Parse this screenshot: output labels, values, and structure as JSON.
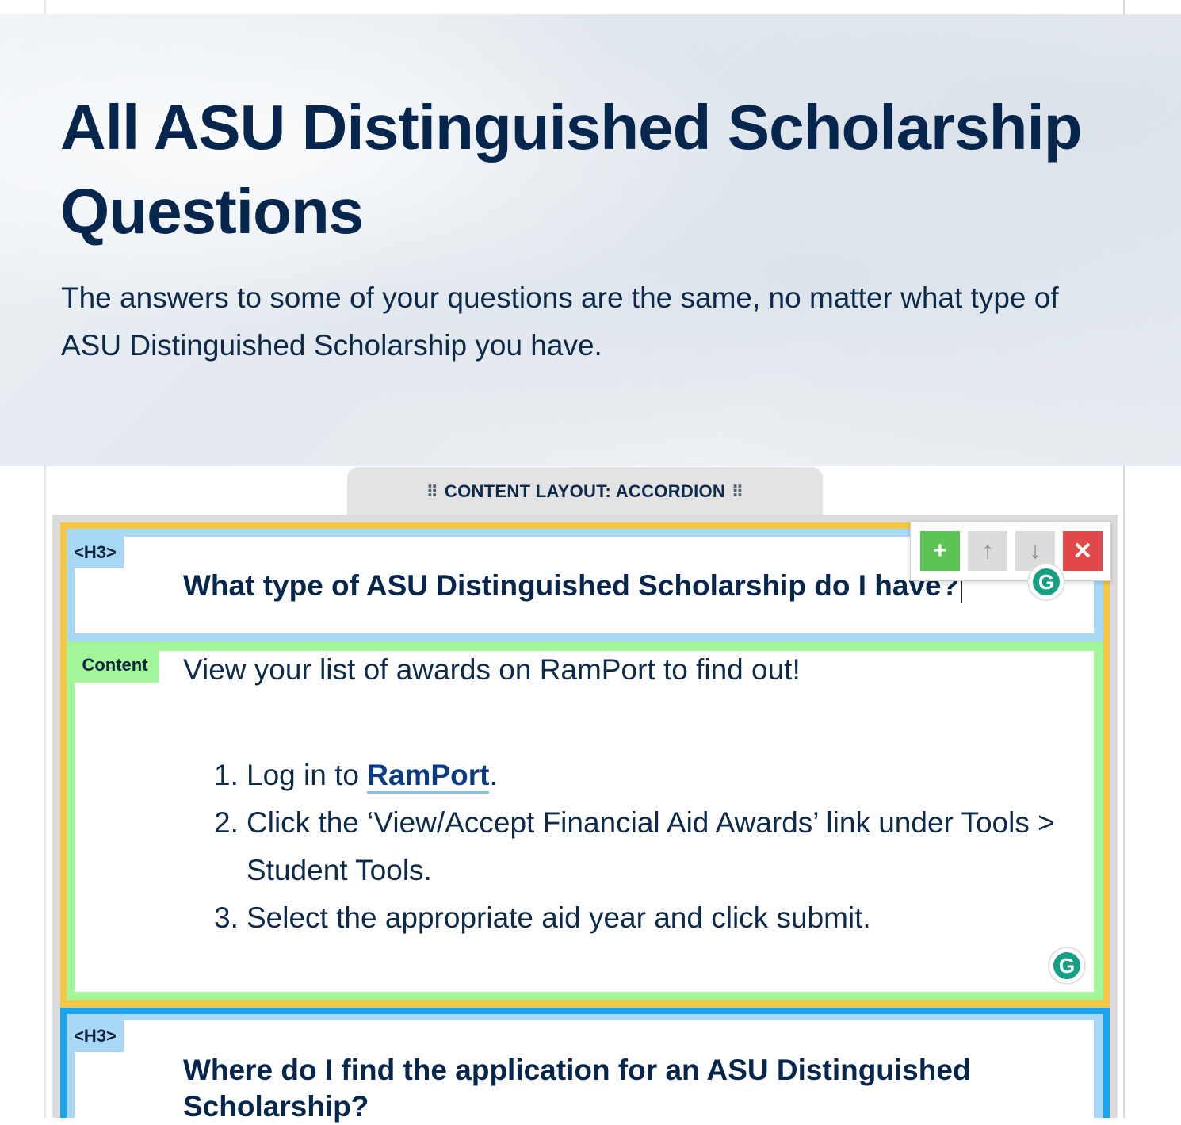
{
  "hero": {
    "title": "All ASU Distinguished Scholarship Questions",
    "description": "The answers to some of your questions are the same, no matter what type of ASU Distinguished Scholarship you have."
  },
  "layout_tab": {
    "label": "CONTENT LAYOUT: ACCORDION",
    "grip_glyph": "⠿"
  },
  "toolbar": {
    "add_glyph": "+",
    "up_glyph": "↑",
    "down_glyph": "↓",
    "delete_glyph": "✕"
  },
  "accordion": {
    "items": [
      {
        "heading_tag": "<H3>",
        "question": "What type of ASU Distinguished Scholarship do I have?",
        "content_tag": "Content",
        "intro": "View your list of awards on RamPort to find out!",
        "steps": [
          {
            "number": "1.",
            "before": "Log in to ",
            "link": "RamPort",
            "after": "."
          },
          {
            "number": "2.",
            "text": "Click the ‘View/Accept Financial Aid Awards’ link under Tools > Student Tools."
          },
          {
            "number": "3.",
            "text": "Select the appropriate aid year and click submit."
          }
        ]
      },
      {
        "heading_tag": "<H3>",
        "question": "Where do I find the application for an ASU Distinguished Scholarship?"
      }
    ]
  },
  "grammarly": {
    "glyph": "G"
  },
  "colors": {
    "title": "#06264e",
    "item_border_active": "#f6c744",
    "item_border": "#1aa5f1",
    "heading_block": "#a9d8f7",
    "content_block": "#a3f59a",
    "link": "#0b3b85",
    "add_button": "#5bc455",
    "delete_button": "#e0484a"
  }
}
